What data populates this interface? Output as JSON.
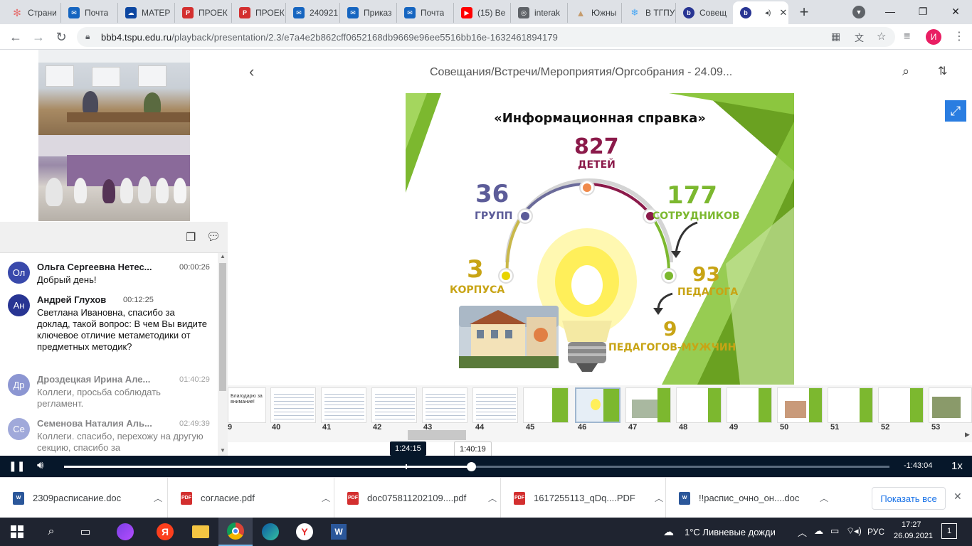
{
  "tabs": [
    {
      "label": "Страни",
      "icon": "pinwheel-icon",
      "color": "#e57373"
    },
    {
      "label": "Почта",
      "icon": "mail-icon",
      "color": "#1565c0"
    },
    {
      "label": "МАТЕР",
      "icon": "cloud-icon",
      "color": "#0d47a1"
    },
    {
      "label": "ПРОЕК",
      "icon": "pdf-icon",
      "color": "#d32f2f"
    },
    {
      "label": "ПРОЕК",
      "icon": "pdf-icon",
      "color": "#d32f2f"
    },
    {
      "label": "240921",
      "icon": "mail-icon",
      "color": "#1565c0"
    },
    {
      "label": "Приказ",
      "icon": "mail-icon",
      "color": "#1565c0"
    },
    {
      "label": "Почта",
      "icon": "mail-icon",
      "color": "#1565c0"
    },
    {
      "label": "(15) Ве",
      "icon": "youtube-icon",
      "color": "#ff0000"
    },
    {
      "label": "interak",
      "icon": "globe-icon",
      "color": "#5f6368"
    },
    {
      "label": "Южны",
      "icon": "mountain-icon",
      "color": "#c69c6d"
    },
    {
      "label": "В ТГПУ",
      "icon": "snowflake-icon",
      "color": "#42a5f5"
    },
    {
      "label": "Совещ",
      "icon": "bbb-icon",
      "color": "#283593"
    },
    {
      "label": "",
      "icon": "bbb-icon",
      "color": "#283593"
    }
  ],
  "url": {
    "host": "bbb4.tspu.edu.ru",
    "path": "/playback/presentation/2.3/e7a4e2b862cff0652168db9669e96ee5516bb16e-1632461894179"
  },
  "profile_initial": "И",
  "presentation": {
    "title": "Совещания/Встречи/Мероприятия/Оргсобрания - 24.09..."
  },
  "slide": {
    "heading": "«Информационная справка»",
    "children_num": "827",
    "children_lbl": "ДЕТЕЙ",
    "groups_num": "36",
    "groups_lbl": "ГРУПП",
    "staff_num": "177",
    "staff_lbl": "СОТРУДНИКОВ",
    "buildings_num": "3",
    "buildings_lbl": "КОРПУСА",
    "teachers_num": "93",
    "teachers_lbl": "ПЕДАГОГА",
    "male_num": "9",
    "male_lbl": "ПЕДАГОГОВ-МУЖЧИН"
  },
  "thumb_numbers": [
    "9",
    "40",
    "41",
    "42",
    "43",
    "44",
    "45",
    "46",
    "47",
    "48",
    "49",
    "50",
    "51",
    "52",
    "53"
  ],
  "thumb_first_text": "Благодарю за внимание!",
  "chat": [
    {
      "initials": "Ол",
      "name": "Ольга Сергеевна Нетес...",
      "time": "00:00:26",
      "text": "Добрый день!",
      "color": "#3949ab"
    },
    {
      "initials": "Ан",
      "name": "Андрей Глухов",
      "time": "00:12:25",
      "text": "Светлана Ивановна, спасибо за доклад, такой вопрос: В чем Вы видите ключевое отличие метаметодики от предметных методик?",
      "color": "#283593"
    },
    {
      "initials": "Др",
      "name": "Дроздецкая Ирина Але...",
      "time": "01:40:29",
      "text": "Коллеги, просьба соблюдать регламент.",
      "color": "#5c6bc0"
    },
    {
      "initials": "Се",
      "name": "Семенова Наталия Аль...",
      "time": "02:49:39",
      "text": "Коллеги. спасибо, перехожу на другую секцию, спасибо за",
      "color": "#7986cb"
    }
  ],
  "player": {
    "tooltip_current": "1:24:15",
    "tooltip_hover": "1:40:19",
    "remaining": "-1:43:04",
    "speed": "1x",
    "progress_fraction": 0.49
  },
  "downloads": [
    {
      "name": "2309расписание.doc",
      "icon": "word-icon",
      "color": "#2b579a"
    },
    {
      "name": "согласие.pdf",
      "icon": "pdf-icon",
      "color": "#d32f2f"
    },
    {
      "name": "doc075811202109....pdf",
      "icon": "pdf-icon",
      "color": "#d32f2f"
    },
    {
      "name": "1617255113_qDq....PDF",
      "icon": "pdf-icon",
      "color": "#d32f2f"
    },
    {
      "name": "!!распис_очно_он....doc",
      "icon": "word-icon",
      "color": "#2b579a"
    }
  ],
  "show_all": "Показать все",
  "tray": {
    "weather": "1°C  Ливневые дожди",
    "lang": "РУС",
    "time": "17:27",
    "date": "26.09.2021",
    "notif": "1"
  }
}
